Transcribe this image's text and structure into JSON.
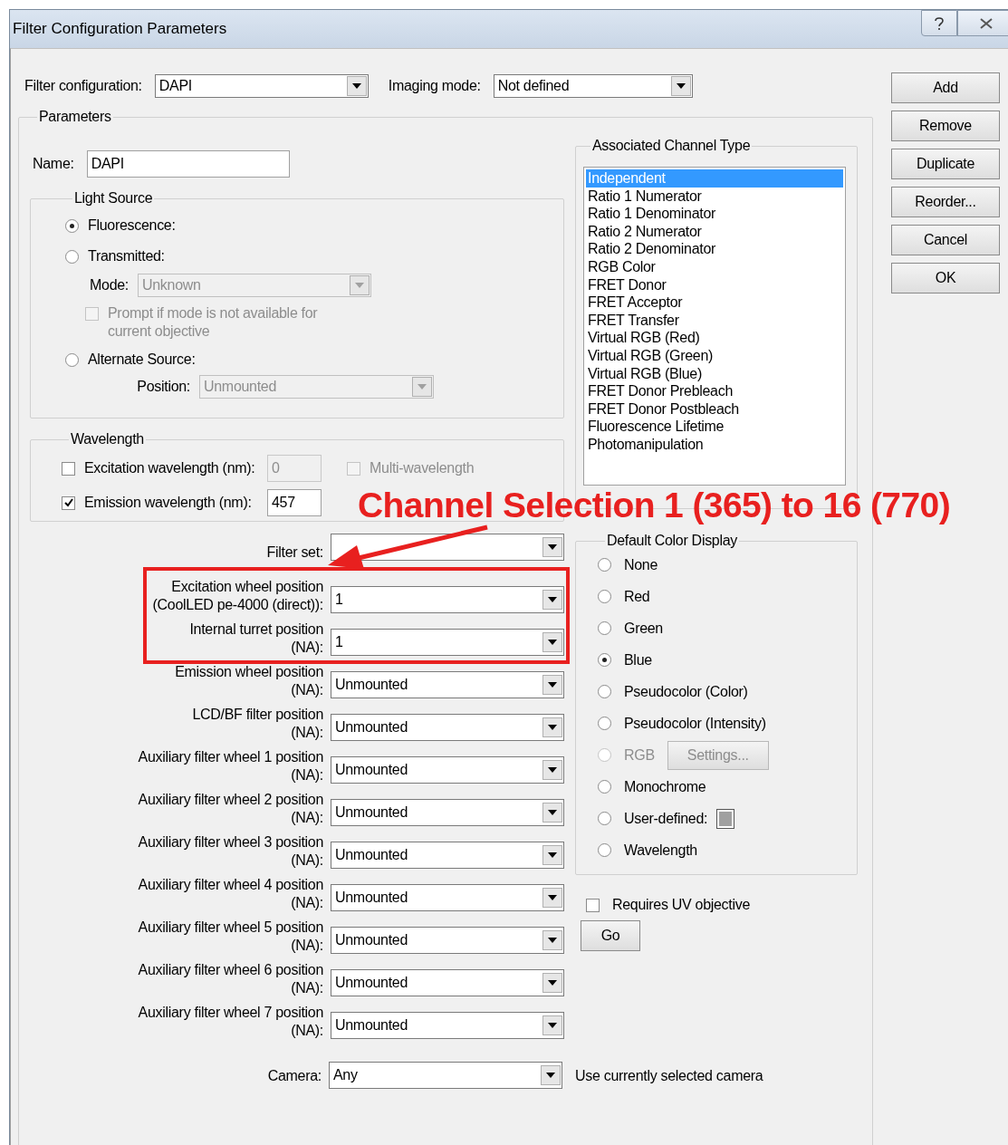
{
  "window": {
    "title": "Filter Configuration Parameters"
  },
  "filter_configuration": {
    "label": "Filter configuration:",
    "value": "DAPI"
  },
  "imaging_mode": {
    "label": "Imaging mode:",
    "value": "Not defined"
  },
  "buttons": [
    "Add",
    "Remove",
    "Duplicate",
    "Reorder...",
    "Cancel",
    "OK"
  ],
  "parameters": {
    "title": "Parameters",
    "name": {
      "label": "Name:",
      "value": "DAPI"
    },
    "light_source": {
      "title": "Light Source",
      "options": [
        {
          "label": "Fluorescence:",
          "selected": true
        },
        {
          "label": "Transmitted:",
          "selected": false
        },
        {
          "label": "Alternate Source:",
          "selected": false
        }
      ],
      "mode": {
        "label": "Mode:",
        "value": "Unknown",
        "disabled": true
      },
      "prompt": {
        "label": [
          "Prompt if mode is not available for",
          "current objective"
        ],
        "checked": false,
        "disabled": true
      },
      "position": {
        "label": "Position:",
        "value": "Unmounted",
        "disabled": true
      }
    },
    "wavelength": {
      "title": "Wavelength",
      "excitation": {
        "label": "Excitation wavelength (nm):",
        "checked": false,
        "value": "0",
        "disabled": true
      },
      "multi": {
        "label": "Multi-wavelength",
        "checked": false,
        "disabled": true
      },
      "emission": {
        "label": "Emission wavelength (nm):",
        "checked": true,
        "value": "457",
        "disabled": false
      }
    },
    "positions": [
      {
        "label": [
          "Filter set:"
        ]
      },
      {
        "label": [
          "Excitation wheel position",
          "(CoolLED pe-4000 (direct)):"
        ],
        "value": "1"
      },
      {
        "label": [
          "Internal turret position",
          "(NA):"
        ],
        "value": "1"
      },
      {
        "label": [
          "Emission wheel position",
          "(NA):"
        ],
        "value": "Unmounted"
      },
      {
        "label": [
          "LCD/BF filter position",
          "(NA):"
        ],
        "value": "Unmounted"
      },
      {
        "label": [
          "Auxiliary filter wheel 1 position",
          "(NA):"
        ],
        "value": "Unmounted"
      },
      {
        "label": [
          "Auxiliary filter wheel 2 position",
          "(NA):"
        ],
        "value": "Unmounted"
      },
      {
        "label": [
          "Auxiliary filter wheel 3 position",
          "(NA):"
        ],
        "value": "Unmounted"
      },
      {
        "label": [
          "Auxiliary filter wheel 4 position",
          "(NA):"
        ],
        "value": "Unmounted"
      },
      {
        "label": [
          "Auxiliary filter wheel 5 position",
          "(NA):"
        ],
        "value": "Unmounted"
      },
      {
        "label": [
          "Auxiliary filter wheel 6 position",
          "(NA):"
        ],
        "value": "Unmounted"
      },
      {
        "label": [
          "Auxiliary filter wheel 7 position",
          "(NA):"
        ],
        "value": "Unmounted"
      }
    ],
    "camera": {
      "label": "Camera:",
      "value": "Any",
      "note": "Use currently selected camera"
    },
    "channel_type": {
      "title": "Associated Channel Type",
      "items": [
        {
          "label": "Independent",
          "selected": true
        },
        {
          "label": "Ratio 1 Numerator",
          "selected": false
        },
        {
          "label": "Ratio 1 Denominator",
          "selected": false
        },
        {
          "label": "Ratio 2 Numerator",
          "selected": false
        },
        {
          "label": "Ratio 2 Denominator",
          "selected": false
        },
        {
          "label": "RGB Color",
          "selected": false
        },
        {
          "label": "FRET Donor",
          "selected": false
        },
        {
          "label": "FRET Acceptor",
          "selected": false
        },
        {
          "label": "FRET Transfer",
          "selected": false
        },
        {
          "label": "Virtual RGB (Red)",
          "selected": false
        },
        {
          "label": "Virtual RGB (Green)",
          "selected": false
        },
        {
          "label": "Virtual RGB (Blue)",
          "selected": false
        },
        {
          "label": "FRET Donor Prebleach",
          "selected": false
        },
        {
          "label": "FRET Donor Postbleach",
          "selected": false
        },
        {
          "label": "Fluorescence Lifetime",
          "selected": false
        },
        {
          "label": "Photomanipulation",
          "selected": false
        }
      ]
    },
    "color_display": {
      "title": "Default Color Display",
      "options": [
        {
          "label": "None",
          "selected": false,
          "disabled": false,
          "kind": "plain"
        },
        {
          "label": "Red",
          "selected": false,
          "disabled": false,
          "kind": "plain"
        },
        {
          "label": "Green",
          "selected": false,
          "disabled": false,
          "kind": "plain"
        },
        {
          "label": "Blue",
          "selected": true,
          "disabled": false,
          "kind": "plain"
        },
        {
          "label": "Pseudocolor (Color)",
          "selected": false,
          "disabled": false,
          "kind": "plain"
        },
        {
          "label": "Pseudocolor (Intensity)",
          "selected": false,
          "disabled": false,
          "kind": "plain"
        },
        {
          "label": "RGB",
          "selected": false,
          "disabled": true,
          "kind": "settings",
          "button": "Settings..."
        },
        {
          "label": "Monochrome",
          "selected": false,
          "disabled": false,
          "kind": "plain"
        },
        {
          "label": "User-defined:",
          "selected": false,
          "disabled": false,
          "kind": "swatch"
        },
        {
          "label": "Wavelength",
          "selected": false,
          "disabled": false,
          "kind": "plain"
        }
      ]
    },
    "requires_uv": {
      "label": "Requires UV objective",
      "checked": false
    },
    "go_button": "Go"
  },
  "annotation": {
    "text": "Channel Selection 1 (365) to 16 (770)"
  }
}
